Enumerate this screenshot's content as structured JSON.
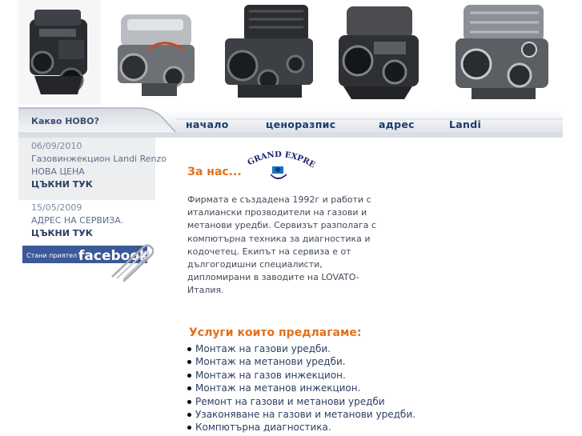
{
  "banner": {
    "engines": [
      "engine-1",
      "engine-2",
      "engine-3",
      "engine-4",
      "engine-5"
    ]
  },
  "nav": {
    "whats_new": "Какво НОВО?",
    "links": [
      "начало",
      "ценоразпис",
      "адрес",
      "Landi"
    ]
  },
  "sidebar": {
    "news": [
      {
        "date": "06/09/2010",
        "title": "Газовинжекцион Landi Renzo",
        "subtitle": "НОВА ЦЕНА",
        "link": "ЦЪКНИ ТУК"
      },
      {
        "date": "15/05/2009",
        "title": "АДРЕС НА СЕРВИЗА.",
        "link": "ЦЪКНИ ТУК"
      }
    ],
    "facebook": {
      "prefix": "Стани приятел в",
      "brand": "facebook"
    }
  },
  "logo": {
    "text": "GRAND EXPRESS"
  },
  "about": {
    "title": "За нас...",
    "text": "Фирмата е създадена 1992г и работи с италиански прозводители на газови и метанови уредби. Сервизът разполага с компютърна техника за диагностика и кодочетец. Екипът на сервиза е от дългогодишни специалисти, дипломирани в заводите на LOVATO-Италия."
  },
  "services": {
    "title": "Услуги които предлагаме:",
    "items": [
      "Монтаж на газови уредби.",
      "Монтаж на метанови уредби.",
      "Монтаж на газов инжекцион.",
      "Монтаж на метанов инжекцион.",
      "Ремонт на газови и метанови уредби",
      "Узаконяване на газови и метанови уредби.",
      "Компютърна диагностика."
    ]
  },
  "colors": {
    "accent_orange": "#e3701b",
    "nav_blue": "#1d3a6b",
    "facebook_blue": "#3b5998"
  }
}
